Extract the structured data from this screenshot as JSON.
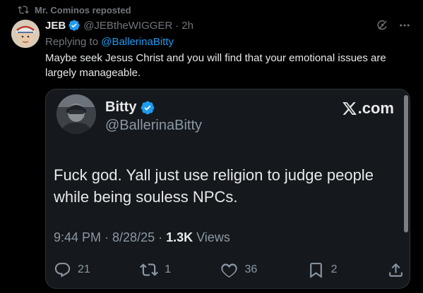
{
  "repost": {
    "label": "Mr. Cominos reposted",
    "icon": "repost-icon"
  },
  "tweet": {
    "author_name": "JEB",
    "author_handle": "@JEBtheWIGGER",
    "separator": "·",
    "time": "2h",
    "replying_prefix": "Replying to ",
    "replying_to": "@BallerinaBitty",
    "text": "Maybe seek Jesus Christ and you will find that your emotional issues are largely manageable.",
    "icons": {
      "verified": "verified-badge-icon",
      "grok": "grok-icon",
      "more": "more-options-icon"
    }
  },
  "quoted_card": {
    "author_name": "Bitty",
    "author_handle": "@BallerinaBitty",
    "brand": ".com",
    "brand_icon": "x-logo-icon",
    "text": "Fuck god. Yall just use religion to judge people while being souless NPCs.",
    "meta_time": "9:44 PM · 8/28/25 · ",
    "views_count": "1.3K",
    "views_label": " Views",
    "actions": {
      "replies": "21",
      "retweets": "1",
      "likes": "36",
      "bookmarks": "2"
    }
  },
  "colors": {
    "background": "#000000",
    "text": "#e7e9ea",
    "muted": "#71767b",
    "accent": "#1d9bf0",
    "card_background": "#15181c"
  }
}
